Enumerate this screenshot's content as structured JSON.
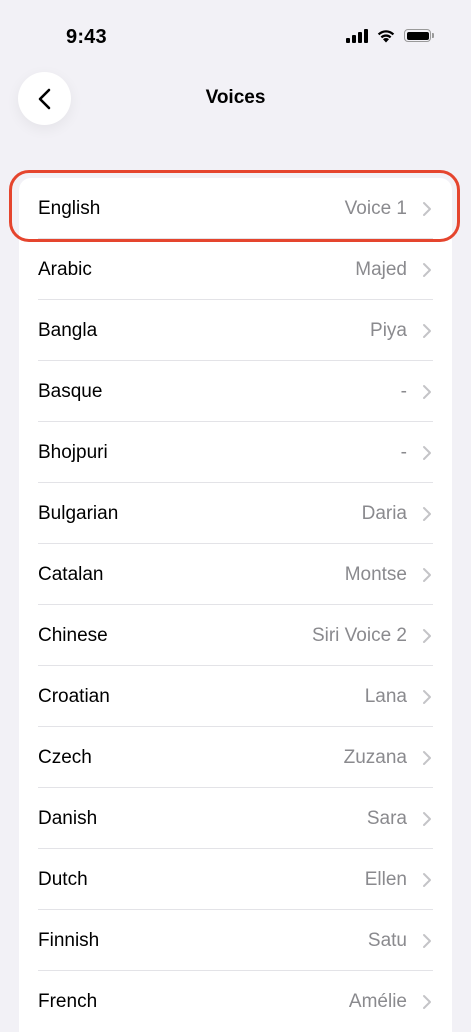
{
  "status_bar": {
    "time": "9:43",
    "icons": [
      "cellular-signal-icon",
      "wifi-icon",
      "battery-icon"
    ]
  },
  "nav": {
    "back_icon": "chevron-left-icon",
    "title": "Voices"
  },
  "voices": [
    {
      "language": "English",
      "voice": "Voice 1"
    },
    {
      "language": "Arabic",
      "voice": "Majed"
    },
    {
      "language": "Bangla",
      "voice": "Piya"
    },
    {
      "language": "Basque",
      "voice": "-"
    },
    {
      "language": "Bhojpuri",
      "voice": "-"
    },
    {
      "language": "Bulgarian",
      "voice": "Daria"
    },
    {
      "language": "Catalan",
      "voice": "Montse"
    },
    {
      "language": "Chinese",
      "voice": "Siri Voice 2"
    },
    {
      "language": "Croatian",
      "voice": "Lana"
    },
    {
      "language": "Czech",
      "voice": "Zuzana"
    },
    {
      "language": "Danish",
      "voice": "Sara"
    },
    {
      "language": "Dutch",
      "voice": "Ellen"
    },
    {
      "language": "Finnish",
      "voice": "Satu"
    },
    {
      "language": "French",
      "voice": "Amélie"
    }
  ],
  "colors": {
    "background": "#f2f1f6",
    "highlight": "#e5452e",
    "secondary_text": "#8a8a8e",
    "chevron": "#c4c4c7"
  }
}
